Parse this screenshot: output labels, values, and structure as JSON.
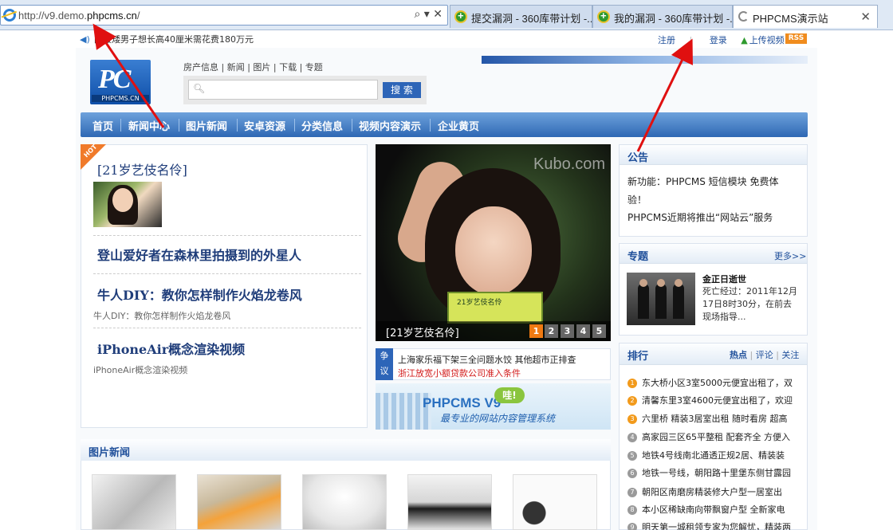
{
  "browser": {
    "address_prefix": "http://v9.demo.",
    "address_host": "phpcms.cn",
    "address_suffix": "/",
    "address_tools": "⌕ ▾ ✕",
    "tabs": [
      {
        "label": "提交漏洞 - 360库带计划 -..."
      },
      {
        "label": "我的漏洞 - 360库带计划 -..."
      },
      {
        "label": "PHPCMS演示站",
        "close": "✕"
      }
    ]
  },
  "topbar": {
    "announce": "国最矮男子想长高40厘米需花费180万元",
    "register": "注册",
    "login": "登录",
    "upload": "上传视频",
    "rss": "RSS"
  },
  "header": {
    "logo_big": "PC",
    "logo_small": "PHPCMS.CN",
    "quick_links": "房产信息 | 新闻 | 图片 | 下载 | 专题",
    "search_button": "搜 索",
    "search_placeholder": ""
  },
  "nav": {
    "items": [
      "首页",
      "新闻中心",
      "图片新闻",
      "安卓资源",
      "分类信息",
      "视频内容演示",
      "企业黄页"
    ]
  },
  "left": {
    "hot": "HOT",
    "headline": "[21岁艺伎名伶]",
    "articles": [
      {
        "title": "登山爱好者在森林里拍摄到的外星人",
        "sub": ""
      },
      {
        "title": "牛人DIY：教你怎样制作火焰龙卷风",
        "sub": "牛人DIY：教你怎样制作火焰龙卷风"
      },
      {
        "title": "iPhoneAir概念渲染视频",
        "sub": "iPhoneAir概念渲染视频"
      }
    ]
  },
  "slideshow": {
    "watermark": "Kubo.com",
    "card_text": "21岁艺伎名伶",
    "caption": "[21岁艺伎名伶]",
    "pages": [
      "1",
      "2",
      "3",
      "4",
      "5"
    ],
    "active_page": 1
  },
  "debate": {
    "label_top": "争",
    "label_bottom": "议",
    "line1": "上海家乐福下架三全问题水饺  其他超市正排查",
    "line2": "浙江放宽小额贷款公司准入条件"
  },
  "ad": {
    "title": "PHPCMS V9",
    "bubble": "哇!",
    "slogan": "最专业的网站内容管理系统"
  },
  "notice": {
    "title": "公告",
    "line1": "新功能：PHPCMS 短信模块 免费体验！",
    "line2": "PHPCMS近期将推出“网站云”服务"
  },
  "topic": {
    "title": "专题",
    "more": "更多>>",
    "name": "金正日逝世",
    "desc": "死亡经过：2011年12月17日8时30分，在前去现场指导..."
  },
  "ranking": {
    "title": "排行",
    "tabs": [
      "热点",
      "评论",
      "关注"
    ],
    "items": [
      {
        "num": "1",
        "text": "东大桥小区3室5000元便宜出租了，双"
      },
      {
        "num": "2",
        "text": "清馨东里3室4600元便宜出租了，欢迎"
      },
      {
        "num": "3",
        "text": "六里桥 精装3居室出租 随时看房 超高"
      },
      {
        "num": "4",
        "text": "高家园三区65平整租 配套齐全 方便入"
      },
      {
        "num": "5",
        "text": "地铁4号线南北通透正规2居、精装装"
      },
      {
        "num": "6",
        "text": "地铁一号线，朝阳路十里堡东侧甘露园"
      },
      {
        "num": "7",
        "text": "朝阳区南磨房精装修大户型一居室出"
      },
      {
        "num": "8",
        "text": "本小区稀缺南向带飘窗户型 全新家电"
      },
      {
        "num": "9",
        "text": "明天第一城租领专家为您解忧，精装两"
      }
    ]
  },
  "picnews": {
    "title": "图片新闻"
  },
  "colors": {
    "nav_top": "#6ea2dc",
    "nav_bottom": "#2e68b4",
    "heading": "#1f4f9a",
    "accent": "#f07a12",
    "annotation_arrow": "#e01010"
  }
}
